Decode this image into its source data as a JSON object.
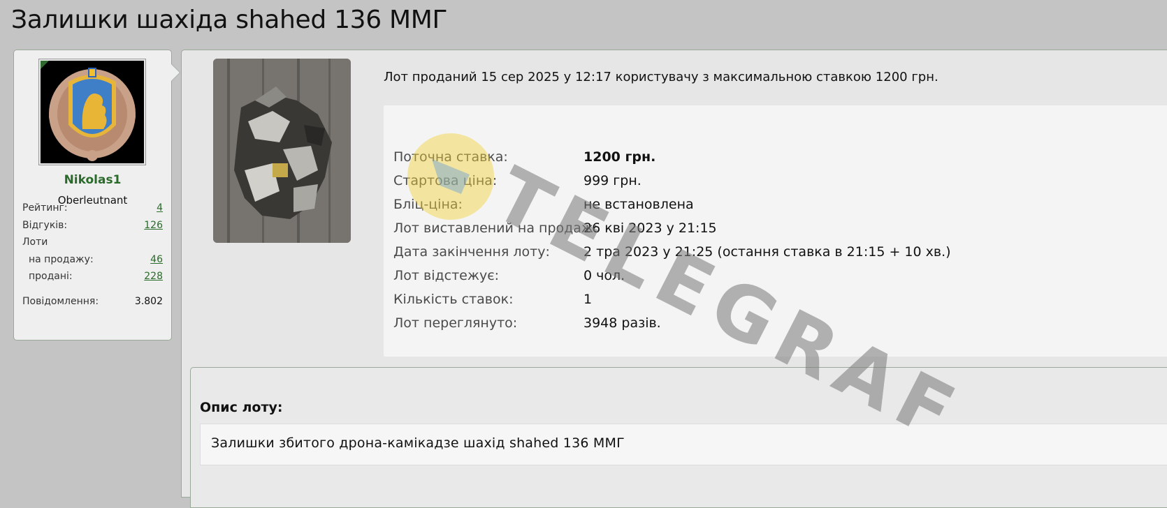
{
  "page": {
    "title": "Залишки шахіда shahed 136 ММГ"
  },
  "user": {
    "name": "Nikolas1",
    "rank": "Oberleutnant",
    "stats": {
      "rating_label": "Рейтинг:",
      "rating_value": "4",
      "reviews_label": "Відгуків:",
      "reviews_value": "126",
      "lots_label": "Лоти",
      "on_sale_label": "на продажу:",
      "on_sale_value": "46",
      "sold_label": "продані:",
      "sold_value": "228",
      "messages_label": "Повідомлення:",
      "messages_value": "3.802"
    }
  },
  "lot": {
    "sold_note": "Лот проданий 15 сер 2025 у 12:17 користувачу з максимальною ставкою 1200 грн.",
    "details": [
      {
        "label": "Поточна ставка:",
        "value": "1200 грн."
      },
      {
        "label": "Стартова ціна:",
        "value": "999 грн."
      },
      {
        "label": "Бліц-ціна:",
        "value": "не встановлена"
      },
      {
        "label": "Лот виставлений на продаж:",
        "value": "26 кві 2023 у 21:15"
      },
      {
        "label": "Дата закінчення лоту:",
        "value": "2 тра 2023 у 21:25 (остання ставка в 21:15 + 10 хв.)"
      },
      {
        "label": "Лот відстежує:",
        "value": "0 чол."
      },
      {
        "label": "Кількість ставок:",
        "value": "1"
      },
      {
        "label": "Лот переглянуто:",
        "value": "3948 разів."
      }
    ],
    "description_title": "Опис лоту:",
    "description_text": "Залишки збитого дрона-камікадзе шахід shahed 136 ММГ"
  },
  "watermark": {
    "text": "TELEGRAF"
  },
  "colors": {
    "accent": "#2a6a2a",
    "background": "#c4c4c4",
    "panel": "#e6e6e6",
    "border": "#9aa89a"
  }
}
